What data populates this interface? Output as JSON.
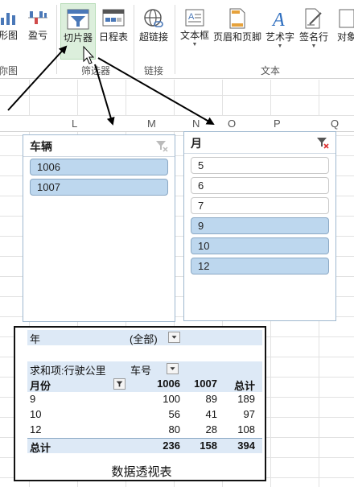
{
  "ribbon": {
    "buttons": [
      {
        "label": "形图",
        "icon": "chart-bars-icon"
      },
      {
        "label": "盈亏",
        "icon": "win-loss-icon"
      },
      {
        "label": "切片器",
        "icon": "slicer-icon"
      },
      {
        "label": "日程表",
        "icon": "timeline-icon"
      },
      {
        "label": "超链接",
        "icon": "globe-link-icon"
      },
      {
        "label": "文本框",
        "icon": "textbox-icon"
      },
      {
        "label": "页眉和页脚",
        "icon": "header-footer-icon"
      },
      {
        "label": "艺术字",
        "icon": "wordart-icon"
      },
      {
        "label": "签名行",
        "icon": "signature-icon"
      },
      {
        "label": "对象",
        "icon": "object-icon"
      }
    ],
    "groups": {
      "sparklines": "你图",
      "filters": "筛选器",
      "links": "链接",
      "text": "文本"
    }
  },
  "columns": [
    "L",
    "M",
    "N",
    "O",
    "P",
    "Q"
  ],
  "slicers": {
    "vehicle": {
      "title": "车辆",
      "items": [
        {
          "label": "1006",
          "selected": true
        },
        {
          "label": "1007",
          "selected": true
        }
      ]
    },
    "month": {
      "title": "月",
      "items": [
        {
          "label": "5",
          "selected": false
        },
        {
          "label": "6",
          "selected": false
        },
        {
          "label": "7",
          "selected": false
        },
        {
          "label": "9",
          "selected": true
        },
        {
          "label": "10",
          "selected": true
        },
        {
          "label": "12",
          "selected": true
        }
      ]
    }
  },
  "pivot": {
    "filter_label": "年",
    "filter_value": "(全部)",
    "value_label": "求和项:行驶公里",
    "column_field": "车号",
    "row_field": "月份",
    "col_headers": [
      "1006",
      "1007",
      "总计"
    ],
    "rows": [
      {
        "label": "9",
        "values": [
          "100",
          "89",
          "189"
        ]
      },
      {
        "label": "10",
        "values": [
          "56",
          "41",
          "97"
        ]
      },
      {
        "label": "12",
        "values": [
          "80",
          "28",
          "108"
        ]
      }
    ],
    "total": {
      "label": "总计",
      "values": [
        "236",
        "158",
        "394"
      ]
    },
    "caption": "数据透视表"
  },
  "colors": {
    "selected_item": "#bdd7ee",
    "pivot_band": "#dde9f6",
    "active_button": "#dcefdc"
  }
}
